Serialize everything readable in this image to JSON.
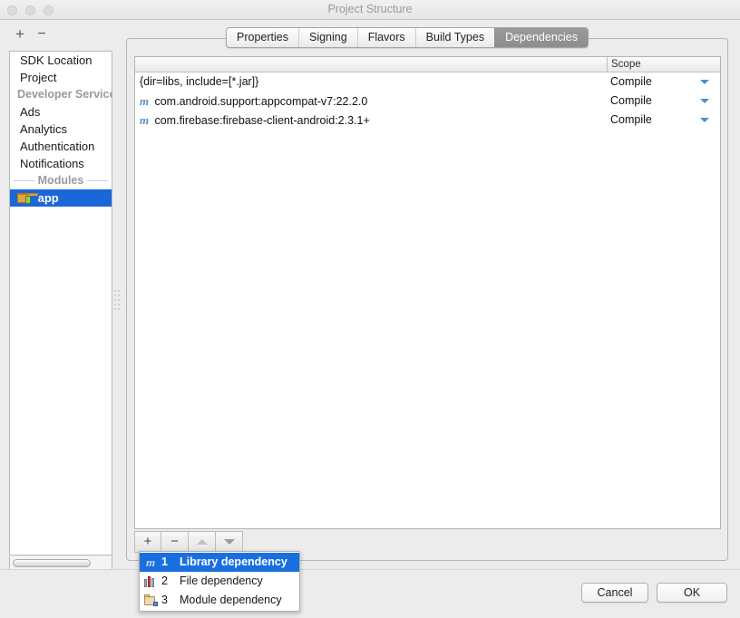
{
  "window": {
    "title": "Project Structure",
    "traffic_lights": [
      "close-button",
      "minimize-button",
      "maximize-button"
    ]
  },
  "left_toolbar": {
    "add_label": "+",
    "remove_label": "−"
  },
  "sidebar": {
    "items": [
      {
        "label": "SDK Location",
        "type": "item",
        "selected": false
      },
      {
        "label": "Project",
        "type": "item",
        "selected": false
      },
      {
        "label": "Developer Services",
        "type": "separator-flush",
        "selected": false
      },
      {
        "label": "Ads",
        "type": "item",
        "selected": false
      },
      {
        "label": "Analytics",
        "type": "item",
        "selected": false
      },
      {
        "label": "Authentication",
        "type": "item",
        "selected": false
      },
      {
        "label": "Notifications",
        "type": "item",
        "selected": false
      },
      {
        "label": "Modules",
        "type": "separator",
        "selected": false
      },
      {
        "label": "app",
        "type": "module",
        "selected": true
      }
    ]
  },
  "tabs": [
    {
      "label": "Properties",
      "active": false
    },
    {
      "label": "Signing",
      "active": false
    },
    {
      "label": "Flavors",
      "active": false
    },
    {
      "label": "Build Types",
      "active": false
    },
    {
      "label": "Dependencies",
      "active": true
    }
  ],
  "table": {
    "columns": [
      "",
      "Scope"
    ],
    "rows": [
      {
        "icon": "",
        "name": "{dir=libs, include=[*.jar]}",
        "scope": "Compile"
      },
      {
        "icon": "maven-icon",
        "name": "com.android.support:appcompat-v7:22.2.0",
        "scope": "Compile"
      },
      {
        "icon": "maven-icon",
        "name": "com.firebase:firebase-client-android:2.3.1+",
        "scope": "Compile"
      }
    ]
  },
  "panel_toolbar": {
    "add_label": "+",
    "remove_label": "−",
    "up_label": "move-up",
    "down_label": "move-down"
  },
  "popup_menu": {
    "items": [
      {
        "icon": "maven-icon",
        "number": "1",
        "label": "Library dependency",
        "selected": true
      },
      {
        "icon": "books-icon",
        "number": "2",
        "label": "File dependency",
        "selected": false
      },
      {
        "icon": "module-folder-icon",
        "number": "3",
        "label": "Module dependency",
        "selected": false
      }
    ]
  },
  "footer": {
    "cancel_label": "Cancel",
    "ok_label": "OK"
  },
  "colors": {
    "selection_blue": "#1a68d8",
    "menu_selection_blue": "#1a6fe0",
    "active_tab_grey": "#8d8d8d",
    "maven_blue": "#5a93c6",
    "dropdown_arrow_blue": "#4e91c9",
    "window_bg": "#ececec"
  }
}
